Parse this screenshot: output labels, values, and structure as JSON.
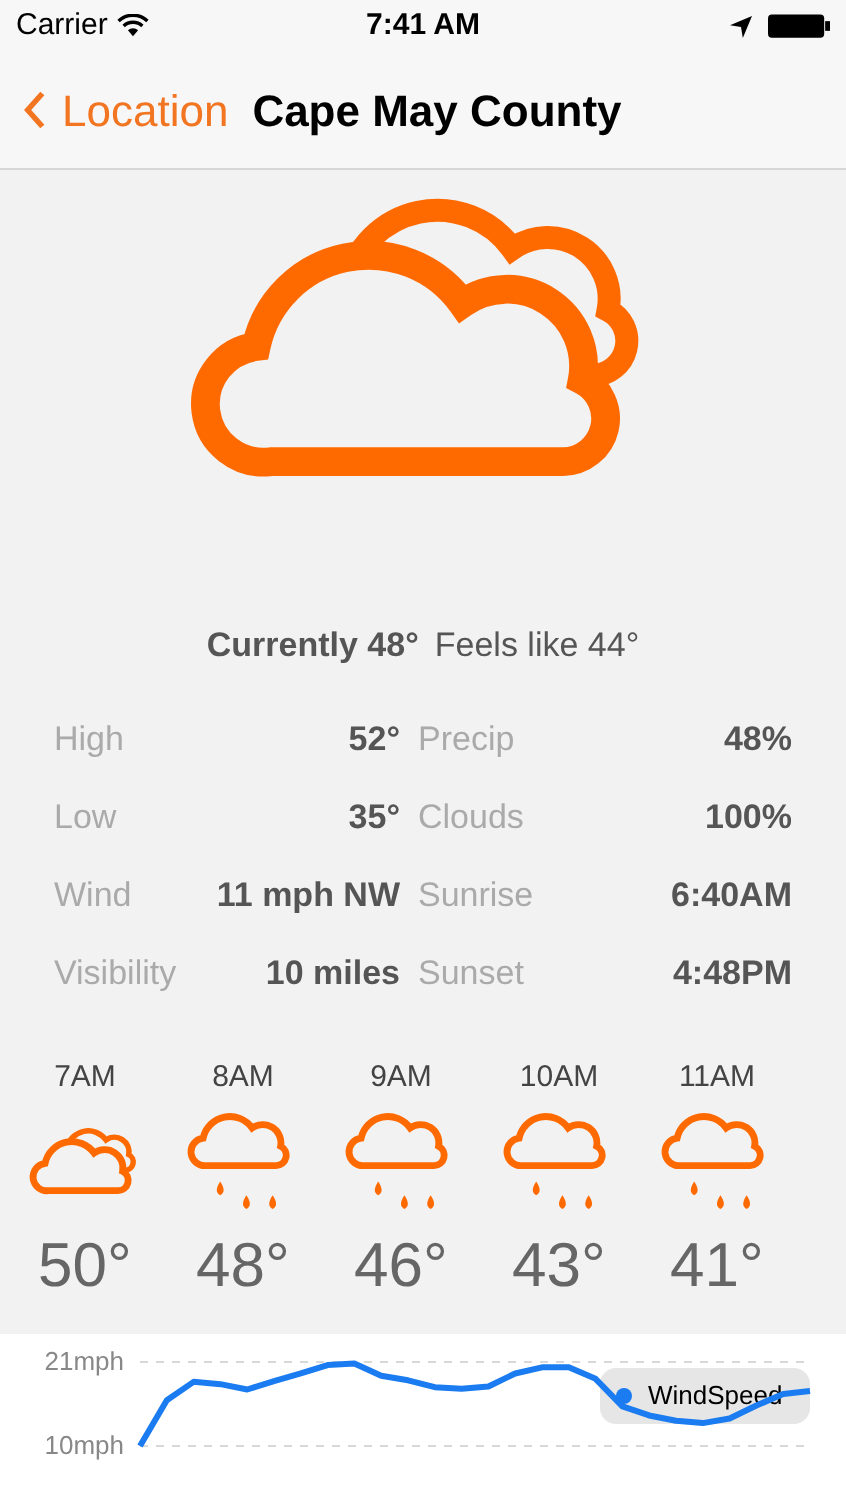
{
  "status_bar": {
    "carrier": "Carrier",
    "time": "7:41 AM"
  },
  "nav": {
    "back": "Location",
    "title": "Cape May County"
  },
  "current": {
    "kind": "cloudy",
    "currently": "Currently 48°",
    "feels_like": "Feels like 44°"
  },
  "details": [
    {
      "label": "High",
      "value": "52°",
      "label_2": "Precip",
      "value_2": "48%"
    },
    {
      "label": "Low",
      "value": "35°",
      "label_2": "Clouds",
      "value_2": "100%"
    },
    {
      "label": "Wind",
      "value": "11 mph NW",
      "label_2": "Sunrise",
      "value_2": "6:40AM"
    },
    {
      "label": "Visibility",
      "value": "10 miles",
      "label_2": "Sunset",
      "value_2": "4:48PM"
    }
  ],
  "hourly": [
    {
      "time": "7AM",
      "kind": "cloudy",
      "temp": "50°"
    },
    {
      "time": "8AM",
      "kind": "rain",
      "temp": "48°"
    },
    {
      "time": "9AM",
      "kind": "rain",
      "temp": "46°"
    },
    {
      "time": "10AM",
      "kind": "rain",
      "temp": "43°"
    },
    {
      "time": "11AM",
      "kind": "rain",
      "temp": "41°"
    }
  ],
  "wind_chart": {
    "chart_data": {
      "type": "line",
      "ylim": [
        10,
        21
      ],
      "yticks": [
        {
          "value": 10,
          "label": "10mph"
        },
        {
          "value": 21,
          "label": "21mph"
        }
      ],
      "series": [
        {
          "name": "WindSpeed",
          "color": "#1a7cf0",
          "values": [
            10,
            16,
            18.4,
            18.1,
            17.4,
            18.5,
            19.5,
            20.6,
            20.8,
            19.2,
            18.6,
            17.7,
            17.5,
            17.8,
            19.5,
            20.3,
            20.3,
            18.8,
            15.2,
            14,
            13.3,
            13,
            13.6,
            15.3,
            16.8,
            17.2
          ]
        }
      ]
    }
  }
}
